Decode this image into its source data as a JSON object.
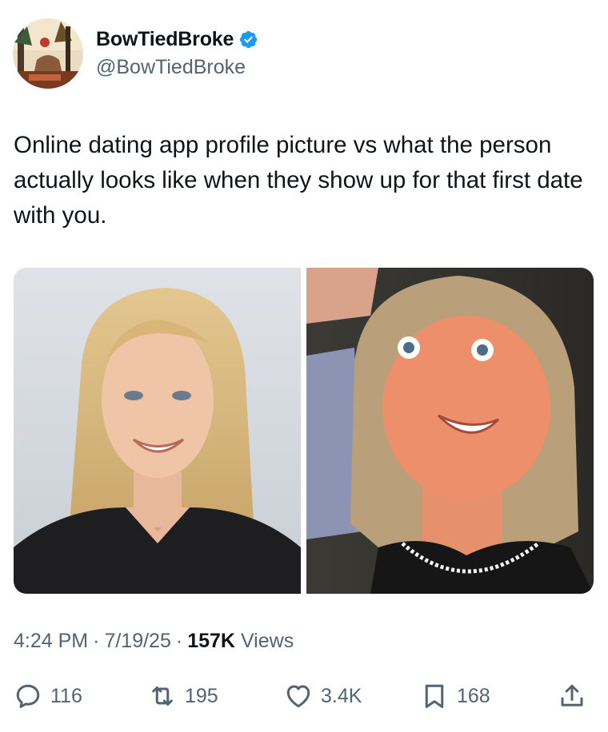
{
  "author": {
    "display_name": "BowTiedBroke",
    "handle": "@BowTiedBroke",
    "verified": true,
    "verified_color": "#1d9bf0"
  },
  "tweet": {
    "text": "Online dating app profile picture vs what the person actually looks like when they show up for that first date with you."
  },
  "media": {
    "left_photo": "profile-headshot",
    "right_photo": "candid-photo"
  },
  "meta": {
    "time": "4:24 PM",
    "date": "7/19/25",
    "views_count": "157K",
    "views_label": "Views"
  },
  "actions": {
    "replies": "116",
    "reposts": "195",
    "likes": "3.4K",
    "bookmarks": "168"
  },
  "colors": {
    "text": "#0f1419",
    "secondary": "#536471",
    "accent": "#1d9bf0"
  }
}
